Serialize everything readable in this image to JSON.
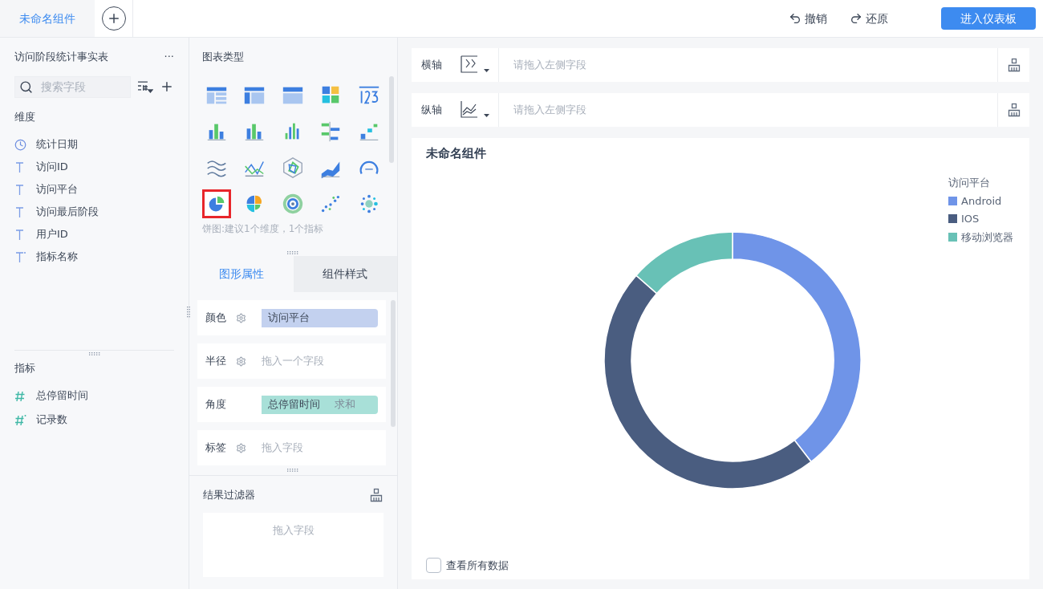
{
  "tabs": [
    {
      "label": "未命名组件",
      "selected": true
    }
  ],
  "toolbar": {
    "undo": "撤销",
    "redo": "还原",
    "primary": "进入仪表板"
  },
  "dataset": {
    "title": "访问阶段统计事实表",
    "more": "···",
    "search": {
      "placeholder": "搜索字段"
    }
  },
  "dimensions": {
    "title": "维度",
    "items": [
      {
        "kind": "date",
        "name": "统计日期"
      },
      {
        "kind": "text",
        "name": "访问ID"
      },
      {
        "kind": "text",
        "name": "访问平台"
      },
      {
        "kind": "text",
        "name": "访问最后阶段"
      },
      {
        "kind": "text",
        "name": "用户ID"
      },
      {
        "kind": "calc-text",
        "name": "指标名称"
      }
    ]
  },
  "measures": {
    "title": "指标",
    "items": [
      {
        "kind": "number",
        "name": "总停留时间"
      },
      {
        "kind": "calc-number",
        "name": "记录数"
      }
    ]
  },
  "chart_types": {
    "title": "图表类型",
    "hint": "饼图:建议1个维度，1个指标",
    "items": [
      {
        "kind": "table",
        "selected": false
      },
      {
        "kind": "crosstable",
        "selected": false
      },
      {
        "kind": "grid",
        "selected": false
      },
      {
        "kind": "heatmap",
        "selected": false
      },
      {
        "kind": "number",
        "selected": false
      },
      {
        "kind": "stacked",
        "selected": false
      },
      {
        "kind": "bar",
        "selected": false
      },
      {
        "kind": "column",
        "selected": false
      },
      {
        "kind": "hbar",
        "selected": false
      },
      {
        "kind": "step",
        "selected": false
      },
      {
        "kind": "multiline",
        "selected": false
      },
      {
        "kind": "line",
        "selected": false
      },
      {
        "kind": "radar",
        "selected": false
      },
      {
        "kind": "area",
        "selected": false
      },
      {
        "kind": "gauge",
        "selected": false
      },
      {
        "kind": "pie",
        "selected": true
      },
      {
        "kind": "rose",
        "selected": false
      },
      {
        "kind": "ring",
        "selected": false
      },
      {
        "kind": "scatter",
        "selected": false
      },
      {
        "kind": "bubble",
        "selected": false
      }
    ]
  },
  "property_tabs": [
    {
      "label": "图形属性",
      "selected": true
    },
    {
      "label": "组件样式",
      "selected": false
    }
  ],
  "properties": [
    {
      "label": "颜色",
      "settings": true,
      "field": "访问平台",
      "kind": "dimension"
    },
    {
      "label": "半径",
      "settings": true,
      "placeholder": "拖入一个字段"
    },
    {
      "label": "角度",
      "settings": false,
      "field": "总停留时间",
      "aggregate": "求和",
      "kind": "measure"
    },
    {
      "label": "标签",
      "settings": true,
      "placeholder": "拖入字段"
    }
  ],
  "result_filter": {
    "title": "结果过滤器",
    "placeholder": "拖入字段"
  },
  "axes": [
    {
      "label": "横轴",
      "placeholder": "请拖入左侧字段"
    },
    {
      "label": "纵轴",
      "placeholder": "请拖入左侧字段"
    }
  ],
  "widget": {
    "title": "未命名组件",
    "legend": {
      "title": "访问平台",
      "items": [
        {
          "name": "Android",
          "color": "#6f94e8"
        },
        {
          "name": "IOS",
          "color": "#4a5d80"
        },
        {
          "name": "移动浏览器",
          "color": "#68c1b6"
        }
      ]
    },
    "show_all": {
      "label": "查看所有数据",
      "checked": false
    }
  }
}
